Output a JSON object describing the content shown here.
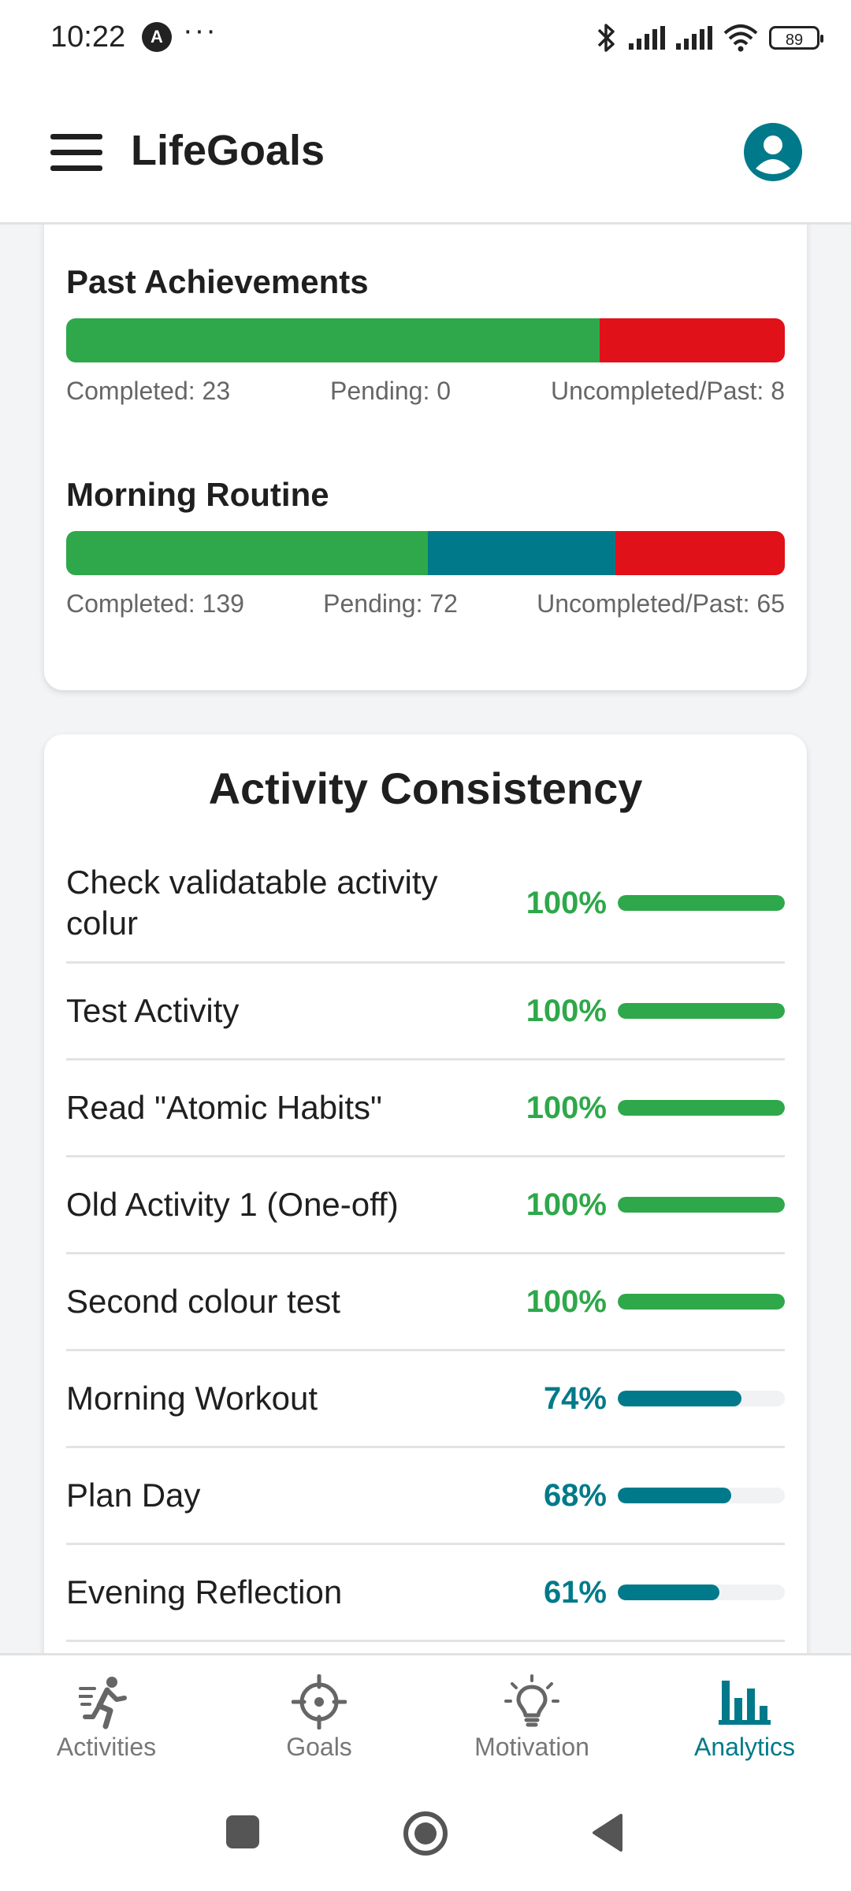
{
  "status_bar": {
    "time": "10:22",
    "notification_badge": "A",
    "more": "···",
    "battery": "89"
  },
  "app_bar": {
    "title": "LifeGoals"
  },
  "colors": {
    "completed": "#2ea84a",
    "pending": "#007a8a",
    "uncompleted": "#e01119",
    "accent": "#007a8a"
  },
  "goals": [
    {
      "title": "Past Achievements",
      "completed_label": "Completed: 23",
      "pending_label": "Pending: 0",
      "uncompleted_label": "Uncompleted/Past: 8",
      "completed": 23,
      "pending": 0,
      "uncompleted": 8
    },
    {
      "title": "Morning Routine",
      "completed_label": "Completed: 139",
      "pending_label": "Pending: 72",
      "uncompleted_label": "Uncompleted/Past: 65",
      "completed": 139,
      "pending": 72,
      "uncompleted": 65
    }
  ],
  "activity_consistency": {
    "title": "Activity Consistency",
    "items": [
      {
        "name": "Check validatable activity colur",
        "percent_label": "100%",
        "value": 100,
        "color": "#2ea84a"
      },
      {
        "name": "Test Activity",
        "percent_label": "100%",
        "value": 100,
        "color": "#2ea84a"
      },
      {
        "name": "Read \"Atomic Habits\"",
        "percent_label": "100%",
        "value": 100,
        "color": "#2ea84a"
      },
      {
        "name": "Old Activity 1 (One-off)",
        "percent_label": "100%",
        "value": 100,
        "color": "#2ea84a"
      },
      {
        "name": "Second colour test",
        "percent_label": "100%",
        "value": 100,
        "color": "#2ea84a"
      },
      {
        "name": "Morning Workout",
        "percent_label": "74%",
        "value": 74,
        "color": "#007a8a"
      },
      {
        "name": "Plan Day",
        "percent_label": "68%",
        "value": 68,
        "color": "#007a8a"
      },
      {
        "name": "Evening Reflection",
        "percent_label": "61%",
        "value": 61,
        "color": "#007a8a"
      }
    ]
  },
  "bottom_nav": {
    "items": [
      {
        "label": "Activities",
        "icon": "running-person-icon",
        "active": false
      },
      {
        "label": "Goals",
        "icon": "crosshair-target-icon",
        "active": false
      },
      {
        "label": "Motivation",
        "icon": "lightbulb-icon",
        "active": false
      },
      {
        "label": "Analytics",
        "icon": "bar-chart-icon",
        "active": true
      }
    ]
  }
}
